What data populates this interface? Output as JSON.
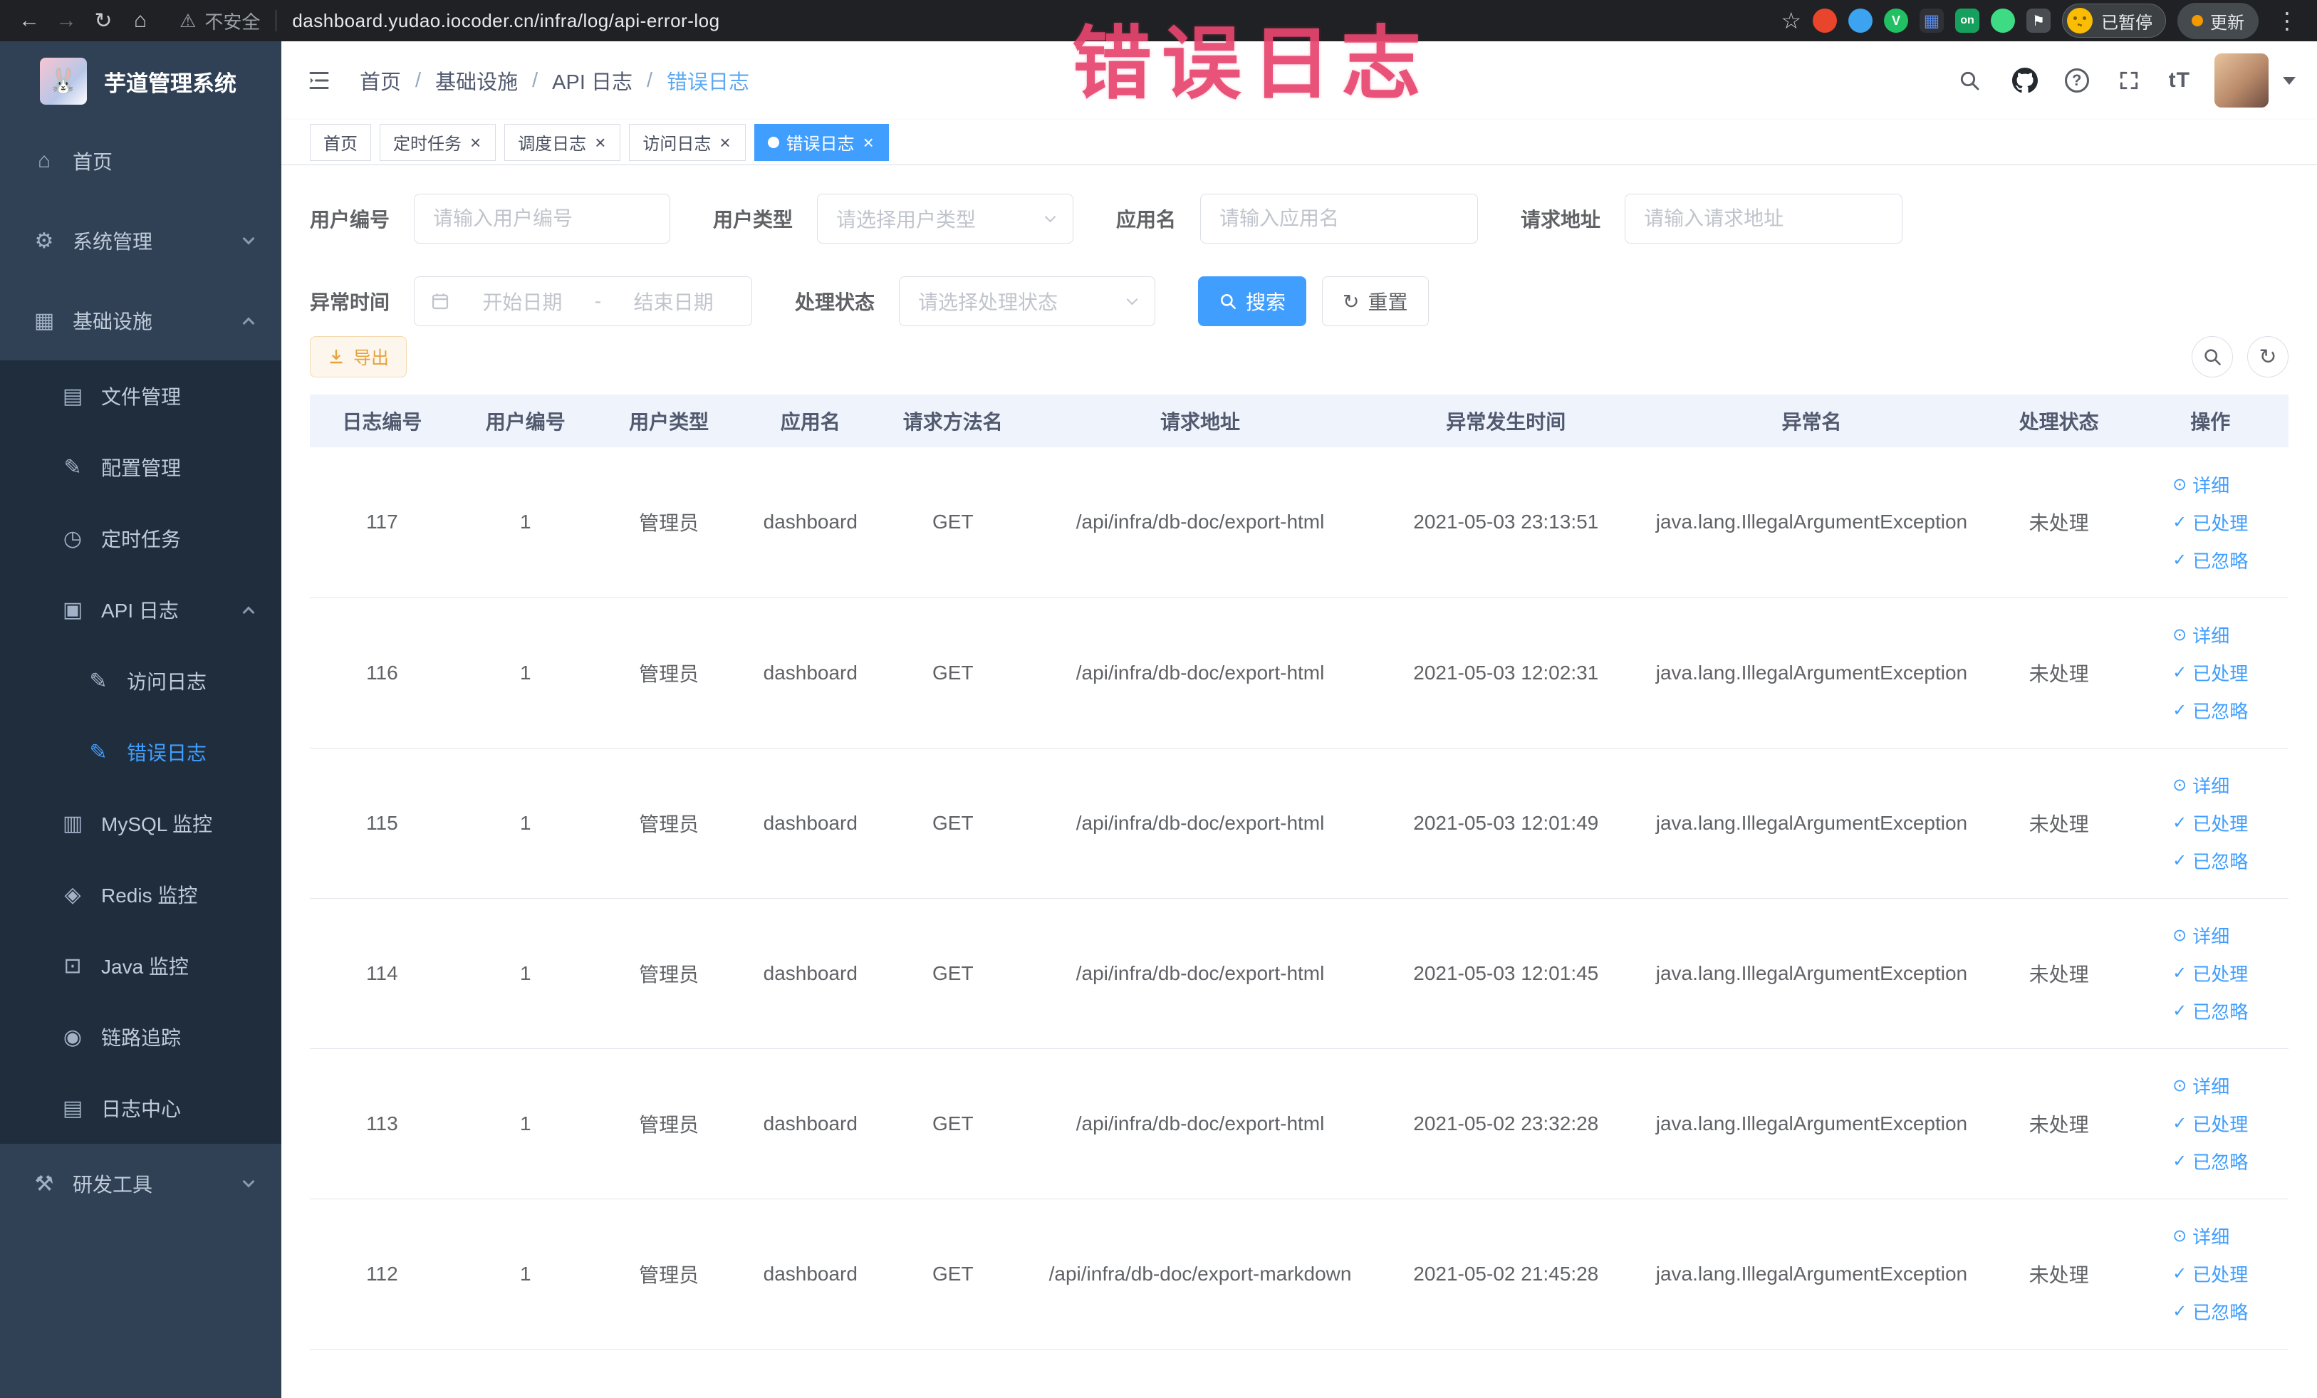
{
  "theme": {
    "accent": "#409eff",
    "chrome_bg": "#202124",
    "sidebar_bg": "#304156",
    "sidebar_sub_bg": "#1f2d3d",
    "sidebar_text": "#bfcbd9",
    "annotation_color": "#e8456e",
    "table_header_bg": "#eef3fc",
    "warning_text": "#e6a23c",
    "warning_bg": "#fdf6ec",
    "warning_border": "#f5dab1"
  },
  "icons": {
    "back": "←",
    "forward": "→",
    "reload": "↻",
    "home": "⌂",
    "warning": "⚠",
    "star": "☆",
    "kebab": "⋮",
    "refresh": "↻",
    "reset": "↻",
    "detail": "⊙",
    "check": "✓",
    "font_size": "tT",
    "help": "?",
    "ext_v_letter": "V",
    "ext_on_badge": "on",
    "ext_grid": "▦",
    "ext_puzzle": "⚑",
    "logo_face": "🐰"
  },
  "browser": {
    "security_label": "不安全",
    "url": "dashboard.yudao.iocoder.cn/infra/log/api-error-log",
    "paused_badge": "已暂停",
    "update_label": "更新"
  },
  "annotation": {
    "text": "错误日志"
  },
  "sidebar": {
    "logo_title": "芋道管理系统",
    "items": [
      {
        "label": "首页",
        "icon": "⌂"
      },
      {
        "label": "系统管理",
        "icon": "⚙"
      },
      {
        "label": "基础设施",
        "icon": "▦"
      },
      {
        "label": "文件管理",
        "icon": "▤"
      },
      {
        "label": "配置管理",
        "icon": "✎"
      },
      {
        "label": "定时任务",
        "icon": "◷"
      },
      {
        "label": "API 日志",
        "icon": "▣"
      },
      {
        "label": "访问日志",
        "icon": "✎"
      },
      {
        "label": "错误日志",
        "icon": "✎"
      },
      {
        "label": "MySQL 监控",
        "icon": "▥"
      },
      {
        "label": "Redis 监控",
        "icon": "◈"
      },
      {
        "label": "Java 监控",
        "icon": "⊡"
      },
      {
        "label": "链路追踪",
        "icon": "◉"
      },
      {
        "label": "日志中心",
        "icon": "▤"
      },
      {
        "label": "研发工具",
        "icon": "⚒"
      }
    ]
  },
  "header": {
    "breadcrumbs": [
      "首页",
      "基础设施",
      "API 日志",
      "错误日志"
    ]
  },
  "tabs": [
    {
      "label": "首页",
      "closable": false,
      "active": false
    },
    {
      "label": "定时任务",
      "closable": true,
      "active": false
    },
    {
      "label": "调度日志",
      "closable": true,
      "active": false
    },
    {
      "label": "访问日志",
      "closable": true,
      "active": false
    },
    {
      "label": "错误日志",
      "closable": true,
      "active": true
    }
  ],
  "filters": {
    "user_id": {
      "label": "用户编号",
      "placeholder": "请输入用户编号"
    },
    "user_type": {
      "label": "用户类型",
      "placeholder": "请选择用户类型"
    },
    "app_name": {
      "label": "应用名",
      "placeholder": "请输入应用名"
    },
    "request_url": {
      "label": "请求地址",
      "placeholder": "请输入请求地址"
    },
    "exception_time": {
      "label": "异常时间",
      "start_placeholder": "开始日期",
      "separator": "-",
      "end_placeholder": "结束日期"
    },
    "process_status": {
      "label": "处理状态",
      "placeholder": "请选择处理状态"
    },
    "search_label": "搜索",
    "reset_label": "重置"
  },
  "toolbar": {
    "export_label": "导出"
  },
  "table": {
    "columns": [
      "日志编号",
      "用户编号",
      "用户类型",
      "应用名",
      "请求方法名",
      "请求地址",
      "异常发生时间",
      "异常名",
      "处理状态",
      "操作"
    ],
    "actions": {
      "detail": "详细",
      "processed": "已处理",
      "ignored": "已忽略"
    },
    "rows": [
      {
        "id": "117",
        "user_id": "1",
        "user_type": "管理员",
        "app": "dashboard",
        "method": "GET",
        "url": "/api/infra/db-doc/export-html",
        "time": "2021-05-03 23:13:51",
        "exception": "java.lang.IllegalArgumentException",
        "status": "未处理"
      },
      {
        "id": "116",
        "user_id": "1",
        "user_type": "管理员",
        "app": "dashboard",
        "method": "GET",
        "url": "/api/infra/db-doc/export-html",
        "time": "2021-05-03 12:02:31",
        "exception": "java.lang.IllegalArgumentException",
        "status": "未处理"
      },
      {
        "id": "115",
        "user_id": "1",
        "user_type": "管理员",
        "app": "dashboard",
        "method": "GET",
        "url": "/api/infra/db-doc/export-html",
        "time": "2021-05-03 12:01:49",
        "exception": "java.lang.IllegalArgumentException",
        "status": "未处理"
      },
      {
        "id": "114",
        "user_id": "1",
        "user_type": "管理员",
        "app": "dashboard",
        "method": "GET",
        "url": "/api/infra/db-doc/export-html",
        "time": "2021-05-03 12:01:45",
        "exception": "java.lang.IllegalArgumentException",
        "status": "未处理"
      },
      {
        "id": "113",
        "user_id": "1",
        "user_type": "管理员",
        "app": "dashboard",
        "method": "GET",
        "url": "/api/infra/db-doc/export-html",
        "time": "2021-05-02 23:32:28",
        "exception": "java.lang.IllegalArgumentException",
        "status": "未处理"
      },
      {
        "id": "112",
        "user_id": "1",
        "user_type": "管理员",
        "app": "dashboard",
        "method": "GET",
        "url": "/api/infra/db-doc/export-markdown",
        "time": "2021-05-02 21:45:28",
        "exception": "java.lang.IllegalArgumentException",
        "status": "未处理"
      }
    ]
  }
}
